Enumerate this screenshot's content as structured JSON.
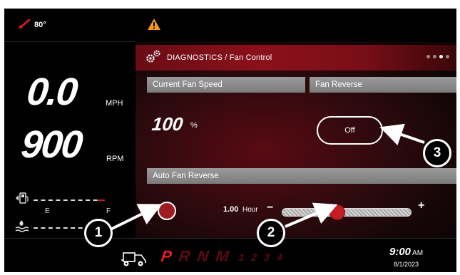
{
  "status": {
    "temperature": "80°",
    "warning_icon": "warning-icon",
    "thermometer_icon": "thermometer-icon"
  },
  "gauges": {
    "speed_value": "0.0",
    "speed_unit": "MPH",
    "rpm_value": "900",
    "rpm_unit": "RPM",
    "fuel_icon": "fuel-pump-icon",
    "coolant_icon": "coolant-icon",
    "e_label": "E",
    "f_label": "F"
  },
  "panel": {
    "title": "DIAGNOSTICS / Fan Control",
    "settings_icon": "gears-icon",
    "page_dots": 3,
    "active_dot": 2,
    "current_fan_speed": {
      "header": "Current Fan Speed",
      "value": "100",
      "unit": "%"
    },
    "fan_reverse": {
      "header": "Fan Reverse",
      "button_label": "Off"
    },
    "auto_fan_reverse": {
      "header": "Auto Fan Reverse",
      "interval_value": "1.00",
      "interval_unit": "Hour",
      "minus_label": "−",
      "plus_label": "+",
      "slider_fraction": 0.45
    }
  },
  "transmission": {
    "gears": [
      "P",
      "R",
      "N",
      "M"
    ],
    "active_gear": "P",
    "manual_gears": [
      "1",
      "2",
      "3",
      "4"
    ],
    "vehicle_icon": "vehicle-icon"
  },
  "clock": {
    "time": "9:00",
    "ampm": "AM",
    "date": "8/1/2023"
  },
  "callouts": [
    "1",
    "2",
    "3"
  ],
  "colors": {
    "accent_red": "#c41d24",
    "panel_dark": "#2d0a0e",
    "header_gray": "#8a8a8a"
  }
}
